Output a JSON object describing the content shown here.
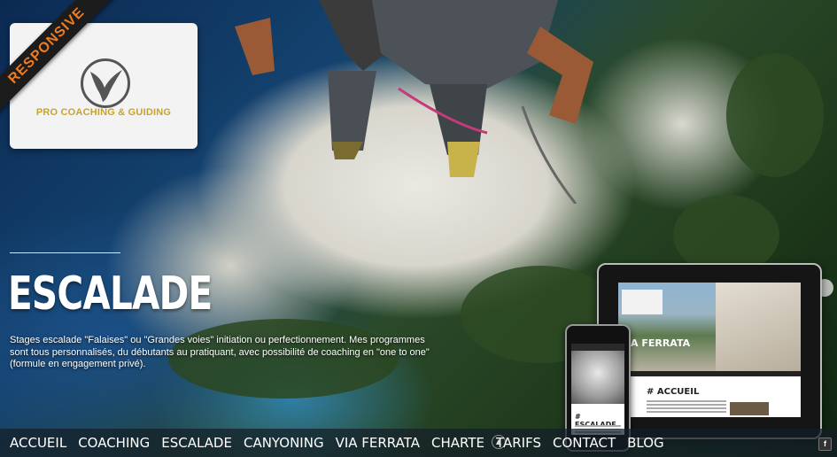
{
  "brand": {
    "ribbon": "RESPONSIVE",
    "logo_text": "PRO COACHING & GUIDING",
    "accent_color": "#f07a1c",
    "logo_color": "#c9a32a"
  },
  "hero": {
    "title": "ESCALADE",
    "description": "Stages escalade \"Falaises\" ou \"Grandes voies\" initiation ou perfectionnement. Mes programmes sont tous personnalisés, du débutants au pratiquant, avec possibilité de coaching en \"one to one\" (formule en engagement privé)."
  },
  "nav": {
    "items": [
      {
        "label": "ACCUEIL"
      },
      {
        "label": "COACHING"
      },
      {
        "label": "ESCALADE"
      },
      {
        "label": "CANYONING"
      },
      {
        "label": "VIA FERRATA"
      },
      {
        "label": "CHARTE"
      },
      {
        "label": "TARIFS"
      },
      {
        "label": "CONTACT"
      },
      {
        "label": "BLOG"
      }
    ]
  },
  "social": {
    "facebook": "f"
  },
  "devices": {
    "tablet_banner": "A FERRATA",
    "tablet_heading": "# ACCUEIL",
    "phone_heading": "# ESCALADE"
  }
}
